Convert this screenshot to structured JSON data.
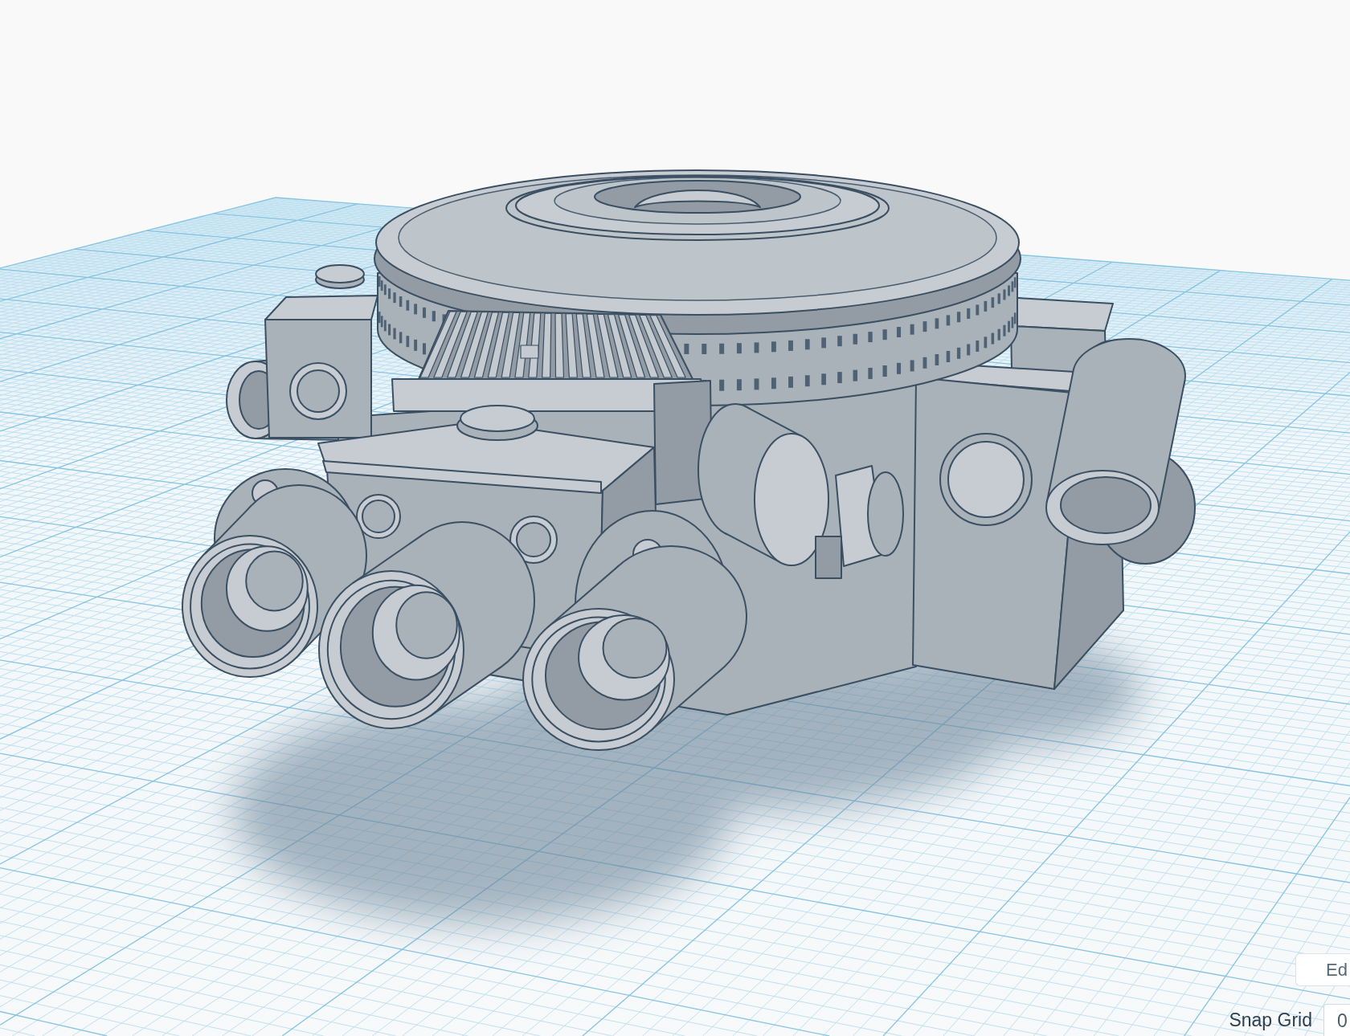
{
  "edit_grid_button": {
    "label": "Ed"
  },
  "snap_grid": {
    "label": "Snap Grid",
    "value": "0"
  }
}
